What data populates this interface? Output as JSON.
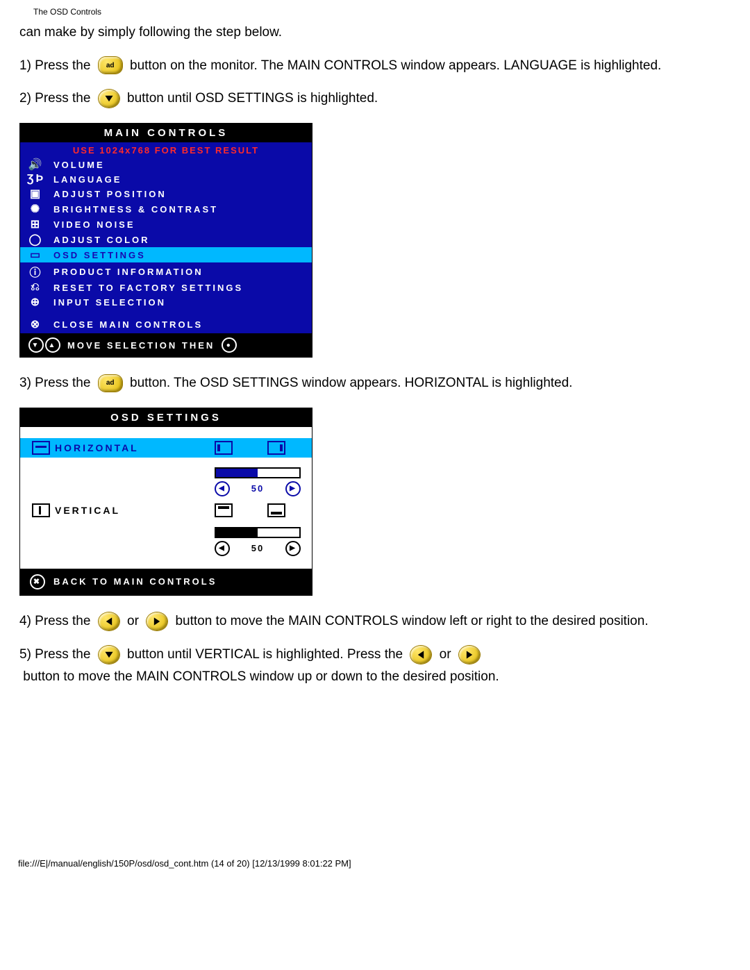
{
  "header": {
    "title": "The OSD Controls"
  },
  "intro": "can make by simply following the step below.",
  "steps": {
    "s1a": "1) Press the ",
    "s1b": " button on the monitor. The MAIN CONTROLS window appears. LANGUAGE is highlighted.",
    "s2a": "2) Press the ",
    "s2b": " button until OSD SETTINGS is highlighted.",
    "s3a": "3) Press the ",
    "s3b": " button. The OSD SETTINGS window appears. HORIZONTAL is highlighted.",
    "s4a": "4) Press the ",
    "s4or": " or ",
    "s4b": " button to move the MAIN CONTROLS window left or right to the desired position.",
    "s5a": "5) Press the ",
    "s5b": " button until VERTICAL is highlighted. Press the ",
    "s5or": " or ",
    "s5c": " button to move the MAIN CONTROLS window up or down to the desired position."
  },
  "buttons": {
    "ok_label": "ad"
  },
  "main_controls": {
    "title": "MAIN CONTROLS",
    "subtitle": "USE 1024x768 FOR BEST RESULT",
    "items": [
      {
        "label": "VOLUME"
      },
      {
        "label": "LANGUAGE"
      },
      {
        "label": "ADJUST POSITION"
      },
      {
        "label": "BRIGHTNESS & CONTRAST"
      },
      {
        "label": "VIDEO NOISE"
      },
      {
        "label": "ADJUST COLOR"
      },
      {
        "label": "OSD SETTINGS"
      },
      {
        "label": "PRODUCT INFORMATION"
      },
      {
        "label": "RESET TO FACTORY SETTINGS"
      },
      {
        "label": "INPUT SELECTION"
      },
      {
        "label": "CLOSE MAIN CONTROLS"
      }
    ],
    "footer": "MOVE SELECTION THEN"
  },
  "osd_settings": {
    "title": "OSD SETTINGS",
    "horizontal": {
      "label": "HORIZONTAL",
      "value": "50"
    },
    "vertical": {
      "label": "VERTICAL",
      "value": "50"
    },
    "back": "BACK TO MAIN CONTROLS"
  },
  "footer": "file:///E|/manual/english/150P/osd/osd_cont.htm (14 of 20) [12/13/1999 8:01:22 PM]"
}
